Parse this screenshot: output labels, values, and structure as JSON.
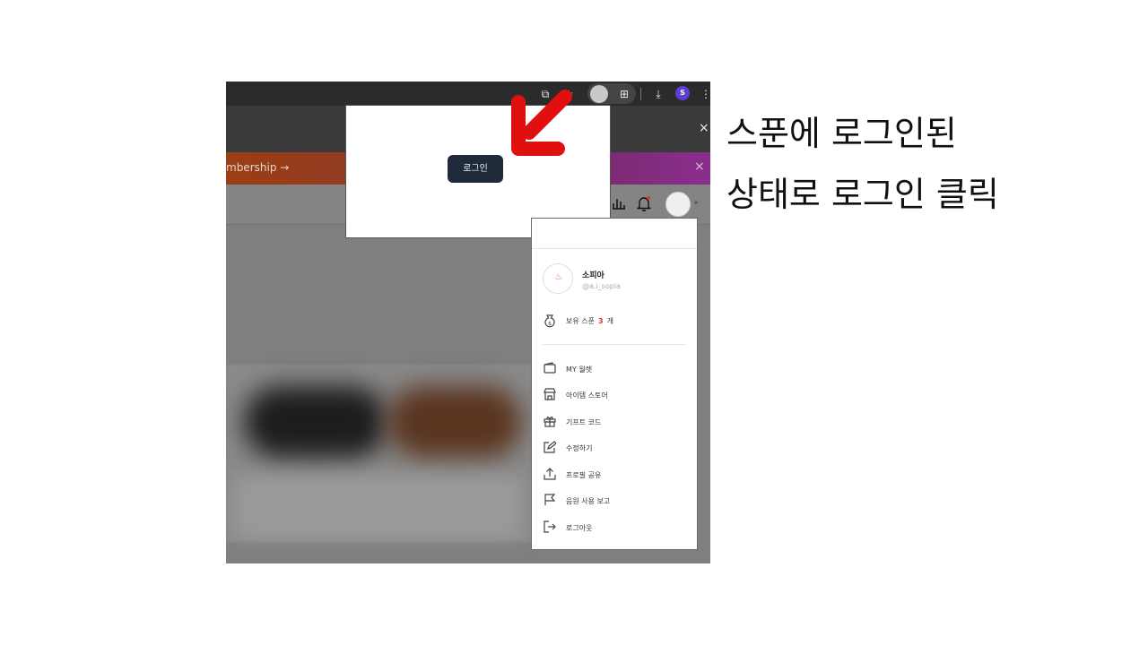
{
  "caption": {
    "line1": "스푼에 로그인된",
    "line2": "상태로 로그인 클릭"
  },
  "browser": {
    "profile_initial": "S",
    "close_symbol": "×"
  },
  "promo": {
    "text": "mbership →"
  },
  "modal": {
    "login_button": "로그인"
  },
  "nav": {
    "chart_icon": "bar-chart-icon",
    "bell_icon": "bell-icon",
    "avatar_icon": "avatar-icon",
    "caret": "▾"
  },
  "dropdown": {
    "profile": {
      "name": "소피아",
      "handle": "@a.i_sopia"
    },
    "spoon": {
      "label": "보유 스푼",
      "count": "3",
      "unit": "개"
    },
    "items": [
      {
        "label": "MY 월렛",
        "icon": "wallet-icon"
      },
      {
        "label": "아이템 스토어",
        "icon": "store-icon"
      },
      {
        "label": "기프트 코드",
        "icon": "gift-icon"
      },
      {
        "label": "수정하기",
        "icon": "edit-icon"
      },
      {
        "label": "프로필 공유",
        "icon": "share-icon"
      },
      {
        "label": "음원 사용 보고",
        "icon": "flag-icon"
      },
      {
        "label": "로그아웃",
        "icon": "logout-icon"
      }
    ]
  }
}
